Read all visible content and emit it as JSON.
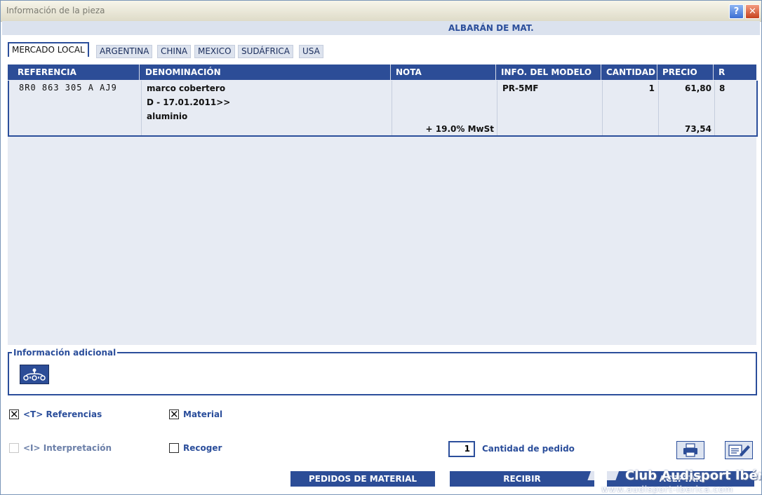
{
  "window": {
    "title": "Información de la pieza",
    "help_label": "?",
    "close_label": "✕"
  },
  "header": {
    "doc_title": "ALBARÁN DE MAT."
  },
  "tabs": [
    {
      "label": "MERCADO LOCAL",
      "active": true
    },
    {
      "label": "ARGENTINA"
    },
    {
      "label": "CHINA"
    },
    {
      "label": "MEXICO"
    },
    {
      "label": "SUDÁFRICA"
    },
    {
      "label": "USA"
    }
  ],
  "table": {
    "columns": [
      "REFERENCIA",
      "DENOMINACIÓN",
      "NOTA",
      "INFO. DEL MODELO",
      "CANTIDAD",
      "PRECIO",
      "R"
    ],
    "row": {
      "referencia": "8R0  863  305  A   AJ9",
      "denominacion": [
        "marco cobertero",
        "D - 17.01.2011>>",
        "aluminio"
      ],
      "nota": "+ 19.0% MwSt",
      "info_modelo": "PR-5MF",
      "cantidad": "1",
      "precio": "61,80",
      "precio_iva": "73,54",
      "r": "8"
    }
  },
  "info": {
    "legend": "Información adicional",
    "icon": "tree-structure-icon"
  },
  "options": {
    "referencias": {
      "label": "<T> Referencias",
      "checked": true
    },
    "material": {
      "label": "Material",
      "checked": true
    },
    "interpretacion": {
      "label": "<I> Interpretación",
      "checked": false,
      "disabled": true
    },
    "recoger": {
      "label": "Recoger",
      "checked": false
    }
  },
  "order": {
    "quantity": "1",
    "quantity_label": "Cantidad de pedido"
  },
  "buttons": {
    "pedidos": "PEDIDOS DE MATERIAL",
    "recibir": "RECIBIR",
    "third": "ACEPTAR",
    "print_icon": "printer-icon",
    "edit_icon": "edit-notes-icon"
  },
  "watermark": {
    "title": "Club Audisport Ibérica",
    "url": "www.audisport-iberica.com"
  },
  "colors": {
    "accent": "#2c4d97",
    "grid_bg": "#e7ebf3",
    "header_band": "#dbe2ee"
  }
}
